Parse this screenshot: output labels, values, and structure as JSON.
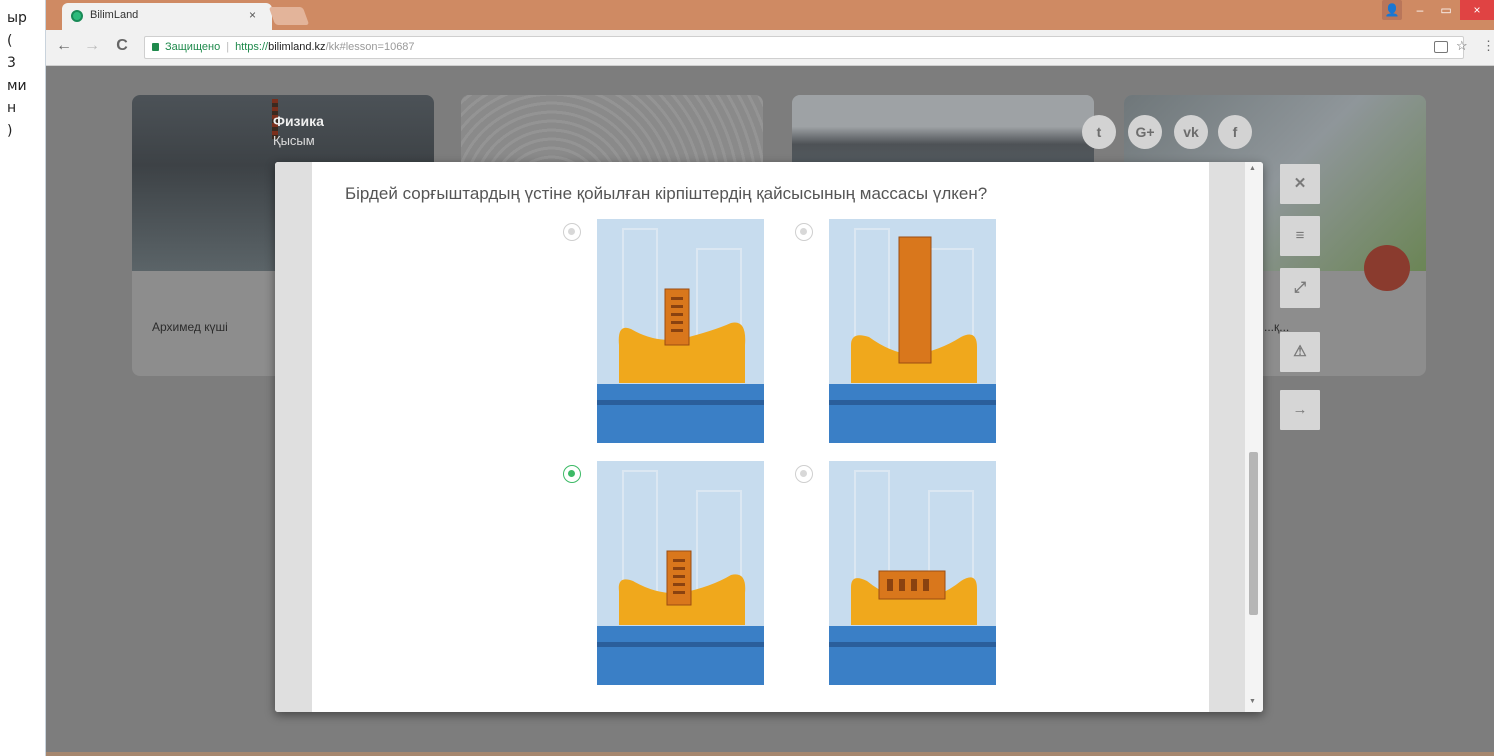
{
  "left_panel": {
    "lines": [
      "ыр",
      "(",
      "3",
      "ми",
      "н",
      ")"
    ]
  },
  "browser": {
    "tab_title": "BilimLand",
    "tab_close": "×",
    "window_controls": {
      "user": "👤",
      "minimize": "–",
      "maximize": "▭",
      "close": "×"
    },
    "nav": {
      "back": "←",
      "forward": "→",
      "reload": "C"
    },
    "address": {
      "secure_label": "Защищено",
      "separator": "|",
      "scheme": "https://",
      "host": "bilimland.kz",
      "path": "/kk#lesson=10687"
    },
    "icons": {
      "translate": "translate-icon",
      "star": "☆",
      "menu": "⋮"
    }
  },
  "cards": [
    {
      "title": "Физика",
      "subtitle": "Қысым",
      "label": "Архимед күші"
    },
    {
      "title": "",
      "subtitle": "",
      "label": ""
    },
    {
      "title": "",
      "subtitle": "",
      "label": ""
    },
    {
      "title": "",
      "subtitle": "",
      "label": "...қ..."
    }
  ],
  "social": {
    "twitter": "t",
    "google_plus": "G+",
    "vk": "vk",
    "facebook": "f"
  },
  "side_buttons": {
    "close": "✕",
    "menu": "≡",
    "expand": "⤢",
    "warning": "⚠",
    "next": "→"
  },
  "quiz": {
    "question": "Бірдей сорғыштардың үстіне қойылған кірпіштердің қайсысының массасы үлкен?",
    "options": [
      {
        "id": "a",
        "selected": false,
        "brick": "small-vertical"
      },
      {
        "id": "b",
        "selected": false,
        "brick": "tall-vertical"
      },
      {
        "id": "c",
        "selected": true,
        "brick": "small-vertical"
      },
      {
        "id": "d",
        "selected": false,
        "brick": "horizontal"
      }
    ]
  },
  "colors": {
    "titlebar": "#cf8a63",
    "overlay": "#7d7d7d",
    "selected_radio": "#3dba66",
    "sponge": "#f0a81c",
    "brick": "#d9771c",
    "water": "#3a7fc6"
  }
}
